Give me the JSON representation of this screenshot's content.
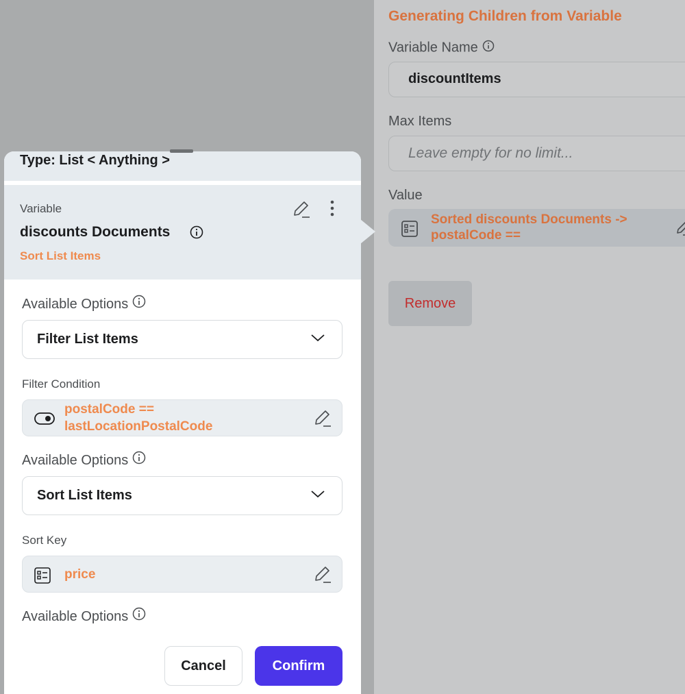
{
  "right_panel": {
    "title": "Generating Children from Variable",
    "variable_name_label": "Variable Name",
    "variable_name_value": "discountItems",
    "max_items_label": "Max Items",
    "max_items_placeholder": "Leave empty for no limit...",
    "value_label": "Value",
    "value_text": "Sorted discounts Documents -> postalCode  == lastLocationPostalCode",
    "remove_label": "Remove"
  },
  "popover": {
    "type_text": "Type: List < Anything >",
    "variable_label": "Variable",
    "variable_name": "discounts Documents",
    "variable_sub": "Sort List Items",
    "options": [
      {
        "label": "Available Options",
        "selected": "Filter List Items",
        "param_label": "Filter Condition",
        "param_icon": "toggle-icon",
        "param_line1": "postalCode  ==",
        "param_line2": "lastLocationPostalCode"
      },
      {
        "label": "Available Options",
        "selected": "Sort List Items",
        "param_label": "Sort Key",
        "param_icon": "data-field-icon",
        "param_value": "price"
      },
      {
        "label": "Available Options"
      }
    ],
    "cancel_label": "Cancel",
    "confirm_label": "Confirm"
  },
  "colors": {
    "accent_orange": "#ef8a4e",
    "confirm_purple": "#4b35e9",
    "remove_red": "#c22d2d"
  }
}
